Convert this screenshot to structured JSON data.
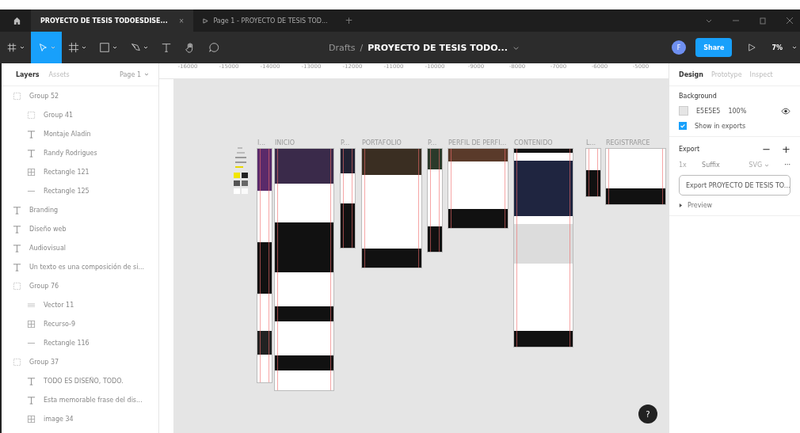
{
  "tabs": [
    {
      "label": "PROYECTO DE TESIS TODOESDISE...",
      "selected": true,
      "close": "×"
    },
    {
      "label": "Page 1 - PROYECTO DE TESIS TOD...",
      "selected": false
    }
  ],
  "new_tab": "+",
  "toolbar": {
    "tools": [
      {
        "kind": "main",
        "selected": false
      },
      {
        "kind": "move",
        "selected": true
      },
      {
        "kind": "frame",
        "selected": false
      },
      {
        "kind": "shape",
        "selected": false
      },
      {
        "kind": "pen",
        "selected": false
      },
      {
        "kind": "text",
        "selected": false
      },
      {
        "kind": "hand",
        "selected": false
      },
      {
        "kind": "comment",
        "selected": false
      }
    ],
    "breadcrumb": "Drafts",
    "separator": "/",
    "file_name": "PROYECTO DE TESIS TODO...",
    "avatar": "F",
    "share": "Share",
    "zoom": "7%"
  },
  "left_panel": {
    "tabs": [
      {
        "label": "Layers",
        "selected": true
      },
      {
        "label": "Assets",
        "selected": false
      }
    ],
    "page": "Page 1",
    "layers": [
      {
        "kind": "group",
        "name": "Group 52",
        "children": [
          {
            "kind": "group",
            "name": "Group 41"
          },
          {
            "kind": "text",
            "name": "Montaje Aladin"
          },
          {
            "kind": "text",
            "name": "Randy Rodrigues"
          },
          {
            "kind": "image",
            "name": "Rectangle 121"
          },
          {
            "kind": "line",
            "name": "Rectangle 125"
          }
        ]
      },
      {
        "kind": "text",
        "name": "Branding"
      },
      {
        "kind": "text",
        "name": "Diseño web"
      },
      {
        "kind": "text",
        "name": "Audiovisual"
      },
      {
        "kind": "text",
        "name": "Un texto es una composición de si..."
      },
      {
        "kind": "group",
        "name": "Group 76",
        "children": [
          {
            "kind": "vector",
            "name": "Vector 11"
          },
          {
            "kind": "image",
            "name": "Recurso-9"
          },
          {
            "kind": "line",
            "name": "Rectangle 116"
          }
        ]
      },
      {
        "kind": "group",
        "name": "Group 37",
        "children": [
          {
            "kind": "text",
            "name": "TODO ES DISEÑO, TODO."
          },
          {
            "kind": "text",
            "name": "Esta memorable frase del dis..."
          },
          {
            "kind": "image",
            "name": "image 34"
          }
        ]
      }
    ]
  },
  "ruler": [
    "-16000",
    "-15000",
    "-14000",
    "-13000",
    "-12000",
    "-11000",
    "-10000",
    "-9000",
    "-8000",
    "-7000",
    "-6000",
    "-5000"
  ],
  "frames": [
    {
      "label": "I..."
    },
    {
      "label": "INICIO"
    },
    {
      "label": "P..."
    },
    {
      "label": "PORTAFOLIO"
    },
    {
      "label": "P..."
    },
    {
      "label": "PERFIL DE PERFI..."
    },
    {
      "label": "CONTENIDO"
    },
    {
      "label": "L..."
    },
    {
      "label": "REGISTRARCE"
    }
  ],
  "help": "?",
  "right_panel": {
    "tabs": [
      {
        "label": "Design",
        "selected": true
      },
      {
        "label": "Prototype",
        "selected": false
      },
      {
        "label": "Inspect",
        "selected": false
      }
    ],
    "background": {
      "title": "Background",
      "color": "#e5e5e5",
      "hex": "E5E5E5",
      "opacity": "100%",
      "show_in_exports": {
        "label": "Show in exports",
        "checked": true
      }
    },
    "export": {
      "title": "Export",
      "minus": "−",
      "plus": "+",
      "scale": "1x",
      "suffix_placeholder": "Suffix",
      "format": "SVG",
      "more": "···",
      "button": "Export PROYECTO DE TESIS TO...",
      "preview": "Preview",
      "preview_expanded": false
    }
  }
}
